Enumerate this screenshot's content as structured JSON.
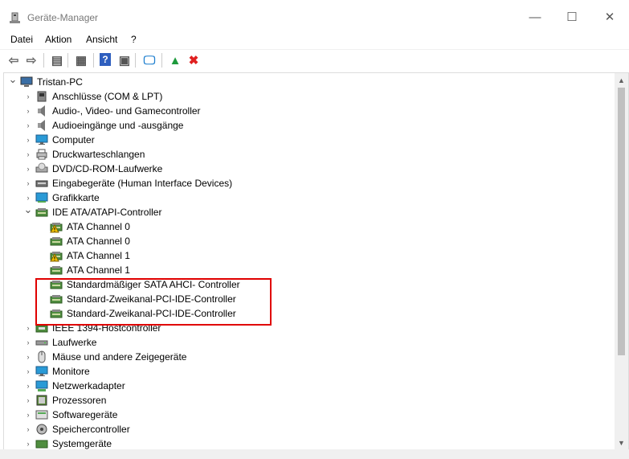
{
  "window": {
    "title": "Geräte-Manager",
    "minimize": "—",
    "maximize": "☐",
    "close": "✕"
  },
  "menu": [
    "Datei",
    "Aktion",
    "Ansicht",
    "?"
  ],
  "toolbar": [
    {
      "name": "back-arrow-icon",
      "glyph": "⇦",
      "color": "#6a6a6a"
    },
    {
      "name": "forward-arrow-icon",
      "glyph": "⇨",
      "color": "#6a6a6a"
    },
    {
      "name": "show-hide-console-tree-icon",
      "glyph": "▤",
      "color": "#555"
    },
    {
      "name": "properties-icon",
      "glyph": "▦",
      "color": "#555"
    },
    {
      "name": "help-icon",
      "glyph": "?",
      "color": "#fff",
      "bg": "#2f5fbf"
    },
    {
      "name": "action-pane-icon",
      "glyph": "▣",
      "color": "#555"
    },
    {
      "name": "scan-hardware-icon",
      "glyph": "🖵",
      "color": "#1e7fcf"
    },
    {
      "name": "update-driver-icon",
      "glyph": "▲",
      "color": "#1d9a3c"
    },
    {
      "name": "uninstall-icon",
      "glyph": "✖",
      "color": "#e02020"
    }
  ],
  "tree": {
    "root": {
      "label": "Tristan-PC",
      "icon": "computer-icon"
    },
    "items": [
      {
        "label": "Anschlüsse (COM & LPT)",
        "icon": "port-icon",
        "state": "collapsed"
      },
      {
        "label": "Audio-, Video- und Gamecontroller",
        "icon": "speaker-icon",
        "state": "collapsed"
      },
      {
        "label": "Audioeingänge und -ausgänge",
        "icon": "speaker-icon",
        "state": "collapsed"
      },
      {
        "label": "Computer",
        "icon": "monitor-icon",
        "state": "collapsed"
      },
      {
        "label": "Druckwarteschlangen",
        "icon": "printer-icon",
        "state": "collapsed"
      },
      {
        "label": "DVD/CD-ROM-Laufwerke",
        "icon": "disc-drive-icon",
        "state": "collapsed"
      },
      {
        "label": "Eingabegeräte (Human Interface Devices)",
        "icon": "hid-icon",
        "state": "collapsed"
      },
      {
        "label": "Grafikkarte",
        "icon": "display-adapter-icon",
        "state": "collapsed"
      },
      {
        "label": "IDE ATA/ATAPI-Controller",
        "icon": "ide-controller-icon",
        "state": "expanded"
      },
      {
        "label": "ATA Channel 0",
        "icon": "ide-controller-warning-icon",
        "child": true,
        "warning": true
      },
      {
        "label": "ATA Channel 0",
        "icon": "ide-controller-icon",
        "child": true
      },
      {
        "label": "ATA Channel 1",
        "icon": "ide-controller-warning-icon",
        "child": true,
        "warning": true
      },
      {
        "label": "ATA Channel 1",
        "icon": "ide-controller-icon",
        "child": true
      },
      {
        "label": "Standardmäßiger SATA AHCI- Controller",
        "icon": "ide-controller-icon",
        "child": true
      },
      {
        "label": "Standard-Zweikanal-PCI-IDE-Controller",
        "icon": "ide-controller-icon",
        "child": true
      },
      {
        "label": "Standard-Zweikanal-PCI-IDE-Controller",
        "icon": "ide-controller-icon",
        "child": true
      },
      {
        "label": "IEEE 1394-Hostcontroller",
        "icon": "ieee1394-icon",
        "state": "collapsed"
      },
      {
        "label": "Laufwerke",
        "icon": "disk-drive-icon",
        "state": "collapsed"
      },
      {
        "label": "Mäuse und andere Zeigegeräte",
        "icon": "mouse-icon",
        "state": "collapsed"
      },
      {
        "label": "Monitore",
        "icon": "monitor-icon",
        "state": "collapsed"
      },
      {
        "label": "Netzwerkadapter",
        "icon": "network-adapter-icon",
        "state": "collapsed"
      },
      {
        "label": "Prozessoren",
        "icon": "processor-icon",
        "state": "collapsed"
      },
      {
        "label": "Softwaregeräte",
        "icon": "software-device-icon",
        "state": "collapsed"
      },
      {
        "label": "Speichercontroller",
        "icon": "storage-controller-icon",
        "state": "collapsed"
      },
      {
        "label": "Systemgeräte",
        "icon": "system-device-icon",
        "state": "collapsed"
      }
    ]
  },
  "colors": {
    "highlight": "#e00000",
    "warning": "#f2c200"
  }
}
